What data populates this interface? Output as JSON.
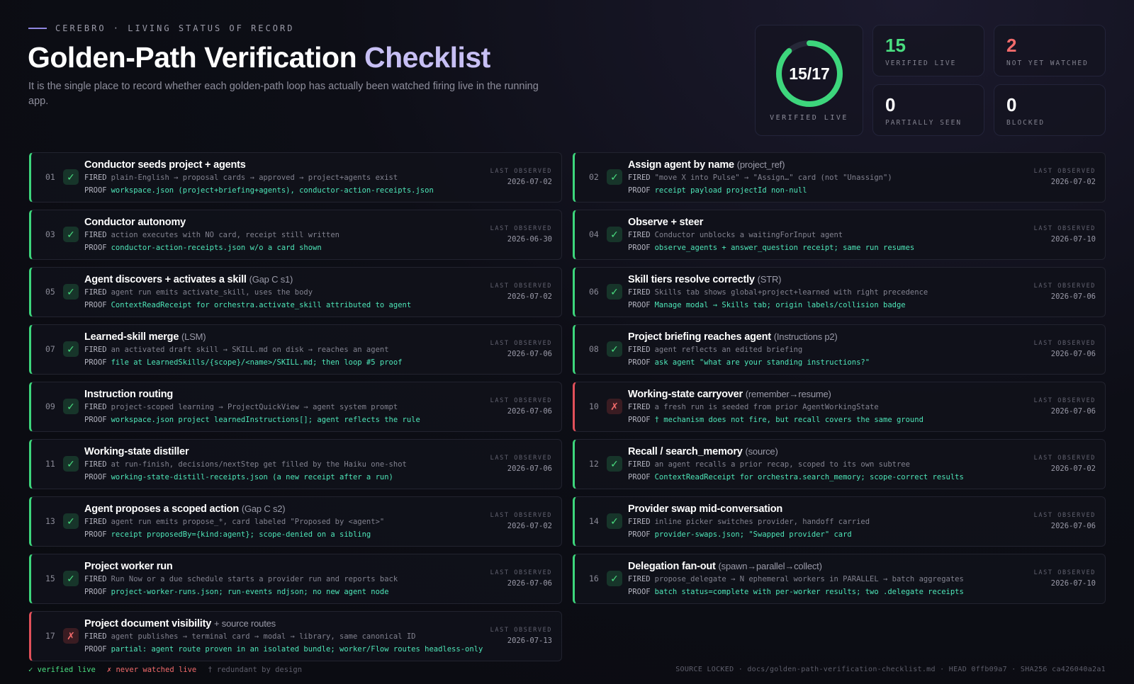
{
  "header": {
    "eyebrow": "CEREBRO · LIVING STATUS OF RECORD",
    "title_main": "Golden-Path Verification ",
    "title_accent": "Checklist",
    "subtitle": "It is the single place to record whether each golden-path loop has actually been watched firing live in the running app."
  },
  "stats": {
    "ring": {
      "value": "15/17",
      "label": "VERIFIED LIVE",
      "verified": 15,
      "total": 17
    },
    "verified": {
      "value": "15",
      "label": "VERIFIED LIVE"
    },
    "not_watched": {
      "value": "2",
      "label": "NOT YET WATCHED"
    },
    "partial": {
      "value": "0",
      "label": "PARTIALLY SEEN"
    },
    "blocked": {
      "value": "0",
      "label": "BLOCKED"
    }
  },
  "labels": {
    "fired": "FIRED",
    "proof": "PROOF",
    "last_observed": "LAST OBSERVED"
  },
  "items": [
    {
      "num": "01",
      "status": "ok",
      "mark": "✓",
      "title": "Conductor seeds project + agents",
      "sub": "",
      "fired": "plain-English → proposal cards → approved → project+agents exist",
      "proof": "workspace.json (project+briefing+agents), conductor-action-receipts.json",
      "date": "2026-07-02"
    },
    {
      "num": "02",
      "status": "ok",
      "mark": "✓",
      "title": "Assign agent by name",
      "sub": "(project_ref)",
      "fired": "\"move X into Pulse\" → \"Assign…\" card (not \"Unassign\")",
      "proof": "receipt payload projectId non-null",
      "date": "2026-07-02"
    },
    {
      "num": "03",
      "status": "ok",
      "mark": "✓",
      "title": "Conductor autonomy",
      "sub": "",
      "fired": "action executes with NO card, receipt still written",
      "proof": "conductor-action-receipts.json w/o a card shown",
      "date": "2026-06-30"
    },
    {
      "num": "04",
      "status": "ok",
      "mark": "✓",
      "title": "Observe + steer",
      "sub": "",
      "fired": "Conductor unblocks a waitingForInput agent",
      "proof": "observe_agents + answer_question receipt; same run resumes",
      "date": "2026-07-10"
    },
    {
      "num": "05",
      "status": "ok",
      "mark": "✓",
      "title": "Agent discovers + activates a skill",
      "sub": "(Gap C s1)",
      "fired": "agent run emits activate_skill, uses the body",
      "proof": "ContextReadReceipt for orchestra.activate_skill attributed to agent",
      "date": "2026-07-02"
    },
    {
      "num": "06",
      "status": "ok",
      "mark": "✓",
      "title": "Skill tiers resolve correctly",
      "sub": "(STR)",
      "fired": "Skills tab shows global+project+learned with right precedence",
      "proof": "Manage modal → Skills tab; origin labels/collision badge",
      "date": "2026-07-06"
    },
    {
      "num": "07",
      "status": "ok",
      "mark": "✓",
      "title": "Learned-skill merge",
      "sub": "(LSM)",
      "fired": "an activated draft skill → SKILL.md on disk → reaches an agent",
      "proof": "file at LearnedSkills/{scope}/<name>/SKILL.md; then loop #5 proof",
      "date": "2026-07-06"
    },
    {
      "num": "08",
      "status": "ok",
      "mark": "✓",
      "title": "Project briefing reaches agent",
      "sub": "(Instructions p2)",
      "fired": "agent reflects an edited briefing",
      "proof": "ask agent \"what are your standing instructions?\"",
      "date": "2026-07-06"
    },
    {
      "num": "09",
      "status": "ok",
      "mark": "✓",
      "title": "Instruction routing",
      "sub": "",
      "fired": "project-scoped learning → ProjectQuickView → agent system prompt",
      "proof": "workspace.json project learnedInstructions[]; agent reflects the rule",
      "date": "2026-07-06"
    },
    {
      "num": "10",
      "status": "fail",
      "mark": "✗",
      "title": "Working-state carryover",
      "sub": "(remember→resume)",
      "fired": "a fresh run is seeded from prior AgentWorkingState",
      "proof": "† mechanism does not fire, but recall covers the same ground",
      "date": "2026-07-06"
    },
    {
      "num": "11",
      "status": "ok",
      "mark": "✓",
      "title": "Working-state distiller",
      "sub": "",
      "fired": "at run-finish, decisions/nextStep get filled by the Haiku one-shot",
      "proof": "working-state-distill-receipts.json (a new receipt after a run)",
      "date": "2026-07-06"
    },
    {
      "num": "12",
      "status": "ok",
      "mark": "✓",
      "title": "Recall / search_memory",
      "sub": "(source)",
      "fired": "an agent recalls a prior recap, scoped to its own subtree",
      "proof": "ContextReadReceipt for orchestra.search_memory; scope-correct results",
      "date": "2026-07-02"
    },
    {
      "num": "13",
      "status": "ok",
      "mark": "✓",
      "title": "Agent proposes a scoped action",
      "sub": "(Gap C s2)",
      "fired": "agent run emits propose_*, card labeled \"Proposed by <agent>\"",
      "proof": "receipt proposedBy={kind:agent}; scope-denied on a sibling",
      "date": "2026-07-02"
    },
    {
      "num": "14",
      "status": "ok",
      "mark": "✓",
      "title": "Provider swap mid-conversation",
      "sub": "",
      "fired": "inline picker switches provider, handoff carried",
      "proof": "provider-swaps.json; \"Swapped provider\" card",
      "date": "2026-07-06"
    },
    {
      "num": "15",
      "status": "ok",
      "mark": "✓",
      "title": "Project worker run",
      "sub": "",
      "fired": "Run Now or a due schedule starts a provider run and reports back",
      "proof": "project-worker-runs.json; run-events ndjson; no new agent node",
      "date": "2026-07-06"
    },
    {
      "num": "16",
      "status": "ok",
      "mark": "✓",
      "title": "Delegation fan-out",
      "sub": "(spawn→parallel→collect)",
      "fired": "propose_delegate → N ephemeral workers in PARALLEL → batch aggregates",
      "proof": "batch status=complete with per-worker results; two .delegate receipts",
      "date": "2026-07-10"
    },
    {
      "num": "17",
      "status": "fail",
      "mark": "✗",
      "title": "Project document visibility",
      "sub": "+ source routes",
      "fired": "agent publishes → terminal card → modal → library, same canonical ID",
      "proof": "partial: agent route proven in an isolated bundle; worker/Flow routes headless-only",
      "date": "2026-07-13"
    }
  ],
  "footer": {
    "legend_ok": "✓ verified live",
    "legend_fail": "✗ never watched live",
    "legend_dag": "† redundant by design",
    "source": "SOURCE LOCKED · docs/golden-path-verification-checklist.md · HEAD 0ffb09a7 · SHA256 ca426040a2a1"
  },
  "colors": {
    "ok": "#4ade80",
    "fail": "#f26b6b",
    "accent": "#c7bff4",
    "proof": "#4ee6b8"
  }
}
